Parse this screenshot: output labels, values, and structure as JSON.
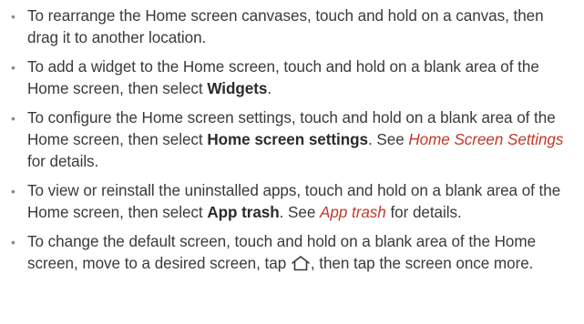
{
  "tips": [
    {
      "text1": "To rearrange the Home screen canvases, touch and hold on a canvas, then drag it to another location."
    },
    {
      "text1": "To add a widget to the Home screen, touch and hold on a blank area of the Home screen, then select ",
      "bold1": "Widgets",
      "text2": "."
    },
    {
      "text1": "To configure the Home screen settings, touch and hold on a blank area of the Home screen, then select ",
      "bold1": "Home screen settings",
      "text2": ". See ",
      "link1": "Home Screen Settings",
      "text3": " for details."
    },
    {
      "text1": "To view or reinstall the uninstalled apps, touch and hold on a blank area of the Home screen, then select ",
      "bold1": "App trash",
      "text2": ". See ",
      "link1": "App trash",
      "text3": " for details."
    },
    {
      "text1": "To change the default screen, touch and hold on a blank area of the Home screen, move to a desired screen, tap ",
      "icon": "home-icon",
      "text2": ", then tap the screen once more."
    }
  ],
  "colors": {
    "text": "#3a3a3a",
    "link": "#c0392b",
    "bullet": "#8a8a8a"
  }
}
